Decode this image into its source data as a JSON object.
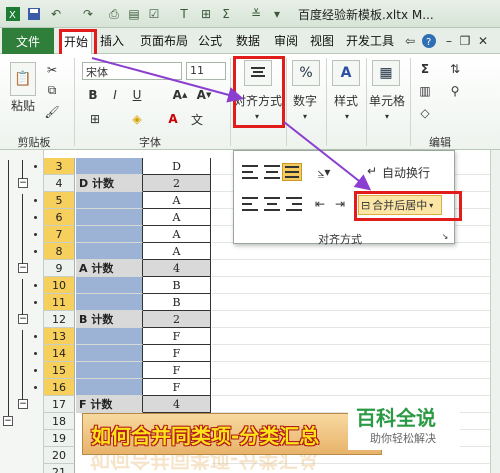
{
  "app": {
    "doc_title": "百度经验新模板.xltx M..."
  },
  "tabs": [
    {
      "id": "file",
      "label": "文件"
    },
    {
      "id": "home",
      "label": "开始"
    },
    {
      "id": "insert",
      "label": "插入"
    },
    {
      "id": "layout",
      "label": "页面布局"
    },
    {
      "id": "formula",
      "label": "公式"
    },
    {
      "id": "data",
      "label": "数据"
    },
    {
      "id": "review",
      "label": "审阅"
    },
    {
      "id": "view",
      "label": "视图"
    },
    {
      "id": "dev",
      "label": "开发工具"
    }
  ],
  "ribbon": {
    "paste_label": "粘贴",
    "font_name": "宋体",
    "font_size": "11",
    "bold": "B",
    "italic": "I",
    "underline": "U",
    "align_label": "对齐方式",
    "number_label": "数字",
    "style_label": "样式",
    "cells_label": "单元格",
    "groups": {
      "clipboard": "剪贴板",
      "font": "字体",
      "edit": "编辑"
    }
  },
  "popup": {
    "wrap_text": "自动换行",
    "merge_center": "合并后居中",
    "group_label": "对齐方式"
  },
  "rows": [
    {
      "num": "3",
      "a": "",
      "b": "D",
      "sel": true,
      "sum": false
    },
    {
      "num": "4",
      "a": "D 计数",
      "b": "2",
      "sel": false,
      "sum": true
    },
    {
      "num": "5",
      "a": "",
      "b": "A",
      "sel": true,
      "sum": false
    },
    {
      "num": "6",
      "a": "",
      "b": "A",
      "sel": true,
      "sum": false
    },
    {
      "num": "7",
      "a": "",
      "b": "A",
      "sel": true,
      "sum": false
    },
    {
      "num": "8",
      "a": "",
      "b": "A",
      "sel": true,
      "sum": false
    },
    {
      "num": "9",
      "a": "A 计数",
      "b": "4",
      "sel": false,
      "sum": true
    },
    {
      "num": "10",
      "a": "",
      "b": "B",
      "sel": true,
      "sum": false
    },
    {
      "num": "11",
      "a": "",
      "b": "B",
      "sel": true,
      "sum": false
    },
    {
      "num": "12",
      "a": "B 计数",
      "b": "2",
      "sel": false,
      "sum": true
    },
    {
      "num": "13",
      "a": "",
      "b": "F",
      "sel": true,
      "sum": false
    },
    {
      "num": "14",
      "a": "",
      "b": "F",
      "sel": true,
      "sum": false
    },
    {
      "num": "15",
      "a": "",
      "b": "F",
      "sel": true,
      "sum": false
    },
    {
      "num": "16",
      "a": "",
      "b": "F",
      "sel": true,
      "sum": false
    },
    {
      "num": "17",
      "a": "F 计数",
      "b": "4",
      "sel": false,
      "sum": true
    },
    {
      "num": "18",
      "a": "",
      "b": "",
      "sel": false,
      "sum": false
    },
    {
      "num": "19",
      "a": "",
      "b": "",
      "sel": false,
      "sum": false
    },
    {
      "num": "20",
      "a": "",
      "b": "",
      "sel": false,
      "sum": false
    },
    {
      "num": "21",
      "a": "",
      "b": "",
      "sel": false,
      "sum": false
    }
  ],
  "banner": {
    "text": "如何合并同类项-分类汇总"
  },
  "logo": {
    "main": "百科全说",
    "sub": "助你轻松解决"
  },
  "colors": {
    "accent": "#2f7f3b",
    "highlight": "#e21b1b",
    "arrow": "#8b3fd0",
    "selection": "#9db3d6"
  }
}
